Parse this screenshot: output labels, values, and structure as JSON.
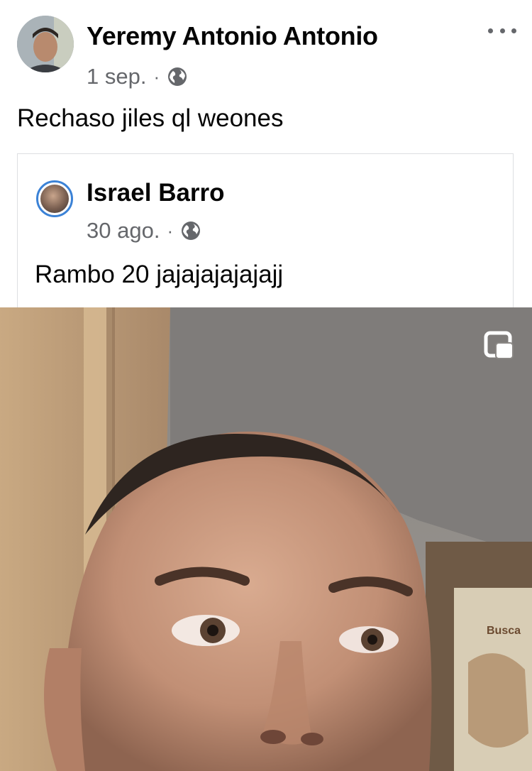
{
  "post": {
    "author": "Yeremy Antonio Antonio",
    "date": "1 sep.",
    "separator": "·",
    "audience_icon": "globe-icon",
    "text": "Rechaso jiles ql weones",
    "more_icon": "more-horizontal-icon"
  },
  "shared_post": {
    "author": "Israel Barro",
    "date": "30 ago.",
    "separator": "·",
    "audience_icon": "globe-icon",
    "text": "Rambo 20 jajajajajajajj"
  },
  "video": {
    "pip_icon": "picture-in-picture-icon",
    "poster_text": "Busca"
  },
  "colors": {
    "text_primary": "#050505",
    "text_secondary": "#65676b",
    "story_ring": "#3b82d6",
    "card_border": "#dddfe2"
  }
}
